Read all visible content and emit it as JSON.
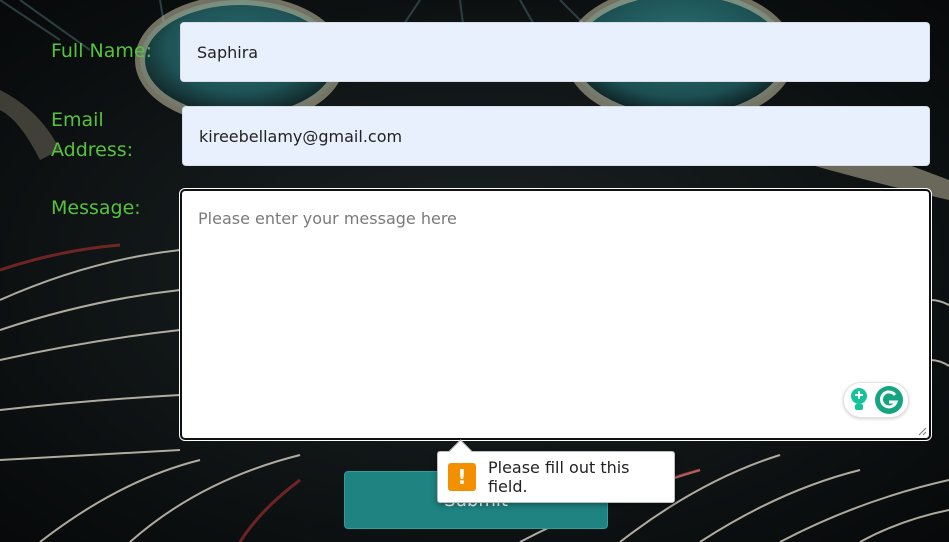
{
  "form": {
    "name_label": "Full Name:",
    "name_value": "Saphira",
    "email_label": "Email Address:",
    "email_value": "kireebellamy@gmail.com",
    "message_label": "Message:",
    "message_value": "",
    "message_placeholder": "Please enter your message here",
    "submit_label": "Submit"
  },
  "validation": {
    "tooltip_text": "Please fill out this field.",
    "warning_icon_glyph": "!"
  },
  "icons": {
    "grammarly_bulb": "lightbulb-icon",
    "grammarly_logo": "grammarly-g-icon",
    "warning": "warning-icon"
  },
  "colors": {
    "label": "#56c23f",
    "input_background": "#e8f0fe",
    "submit_background": "#1e8381",
    "warning": "#f29000",
    "grammarly": "#15c39a"
  }
}
